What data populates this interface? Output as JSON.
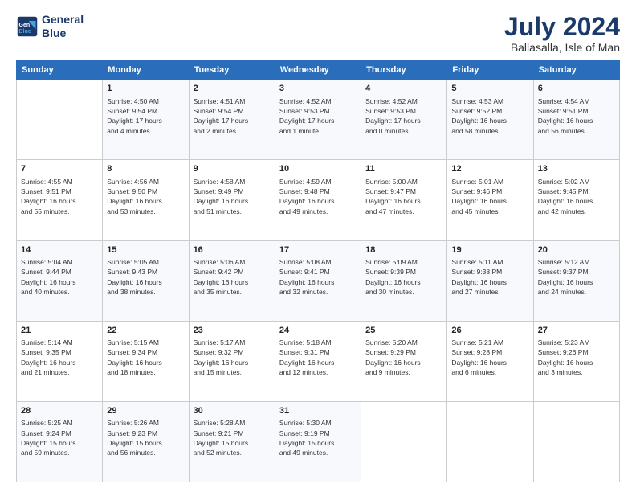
{
  "logo": {
    "line1": "General",
    "line2": "Blue"
  },
  "title": "July 2024",
  "subtitle": "Ballasalla, Isle of Man",
  "days_header": [
    "Sunday",
    "Monday",
    "Tuesday",
    "Wednesday",
    "Thursday",
    "Friday",
    "Saturday"
  ],
  "weeks": [
    [
      {
        "num": "",
        "info": ""
      },
      {
        "num": "1",
        "info": "Sunrise: 4:50 AM\nSunset: 9:54 PM\nDaylight: 17 hours\nand 4 minutes."
      },
      {
        "num": "2",
        "info": "Sunrise: 4:51 AM\nSunset: 9:54 PM\nDaylight: 17 hours\nand 2 minutes."
      },
      {
        "num": "3",
        "info": "Sunrise: 4:52 AM\nSunset: 9:53 PM\nDaylight: 17 hours\nand 1 minute."
      },
      {
        "num": "4",
        "info": "Sunrise: 4:52 AM\nSunset: 9:53 PM\nDaylight: 17 hours\nand 0 minutes."
      },
      {
        "num": "5",
        "info": "Sunrise: 4:53 AM\nSunset: 9:52 PM\nDaylight: 16 hours\nand 58 minutes."
      },
      {
        "num": "6",
        "info": "Sunrise: 4:54 AM\nSunset: 9:51 PM\nDaylight: 16 hours\nand 56 minutes."
      }
    ],
    [
      {
        "num": "7",
        "info": "Sunrise: 4:55 AM\nSunset: 9:51 PM\nDaylight: 16 hours\nand 55 minutes."
      },
      {
        "num": "8",
        "info": "Sunrise: 4:56 AM\nSunset: 9:50 PM\nDaylight: 16 hours\nand 53 minutes."
      },
      {
        "num": "9",
        "info": "Sunrise: 4:58 AM\nSunset: 9:49 PM\nDaylight: 16 hours\nand 51 minutes."
      },
      {
        "num": "10",
        "info": "Sunrise: 4:59 AM\nSunset: 9:48 PM\nDaylight: 16 hours\nand 49 minutes."
      },
      {
        "num": "11",
        "info": "Sunrise: 5:00 AM\nSunset: 9:47 PM\nDaylight: 16 hours\nand 47 minutes."
      },
      {
        "num": "12",
        "info": "Sunrise: 5:01 AM\nSunset: 9:46 PM\nDaylight: 16 hours\nand 45 minutes."
      },
      {
        "num": "13",
        "info": "Sunrise: 5:02 AM\nSunset: 9:45 PM\nDaylight: 16 hours\nand 42 minutes."
      }
    ],
    [
      {
        "num": "14",
        "info": "Sunrise: 5:04 AM\nSunset: 9:44 PM\nDaylight: 16 hours\nand 40 minutes."
      },
      {
        "num": "15",
        "info": "Sunrise: 5:05 AM\nSunset: 9:43 PM\nDaylight: 16 hours\nand 38 minutes."
      },
      {
        "num": "16",
        "info": "Sunrise: 5:06 AM\nSunset: 9:42 PM\nDaylight: 16 hours\nand 35 minutes."
      },
      {
        "num": "17",
        "info": "Sunrise: 5:08 AM\nSunset: 9:41 PM\nDaylight: 16 hours\nand 32 minutes."
      },
      {
        "num": "18",
        "info": "Sunrise: 5:09 AM\nSunset: 9:39 PM\nDaylight: 16 hours\nand 30 minutes."
      },
      {
        "num": "19",
        "info": "Sunrise: 5:11 AM\nSunset: 9:38 PM\nDaylight: 16 hours\nand 27 minutes."
      },
      {
        "num": "20",
        "info": "Sunrise: 5:12 AM\nSunset: 9:37 PM\nDaylight: 16 hours\nand 24 minutes."
      }
    ],
    [
      {
        "num": "21",
        "info": "Sunrise: 5:14 AM\nSunset: 9:35 PM\nDaylight: 16 hours\nand 21 minutes."
      },
      {
        "num": "22",
        "info": "Sunrise: 5:15 AM\nSunset: 9:34 PM\nDaylight: 16 hours\nand 18 minutes."
      },
      {
        "num": "23",
        "info": "Sunrise: 5:17 AM\nSunset: 9:32 PM\nDaylight: 16 hours\nand 15 minutes."
      },
      {
        "num": "24",
        "info": "Sunrise: 5:18 AM\nSunset: 9:31 PM\nDaylight: 16 hours\nand 12 minutes."
      },
      {
        "num": "25",
        "info": "Sunrise: 5:20 AM\nSunset: 9:29 PM\nDaylight: 16 hours\nand 9 minutes."
      },
      {
        "num": "26",
        "info": "Sunrise: 5:21 AM\nSunset: 9:28 PM\nDaylight: 16 hours\nand 6 minutes."
      },
      {
        "num": "27",
        "info": "Sunrise: 5:23 AM\nSunset: 9:26 PM\nDaylight: 16 hours\nand 3 minutes."
      }
    ],
    [
      {
        "num": "28",
        "info": "Sunrise: 5:25 AM\nSunset: 9:24 PM\nDaylight: 15 hours\nand 59 minutes."
      },
      {
        "num": "29",
        "info": "Sunrise: 5:26 AM\nSunset: 9:23 PM\nDaylight: 15 hours\nand 56 minutes."
      },
      {
        "num": "30",
        "info": "Sunrise: 5:28 AM\nSunset: 9:21 PM\nDaylight: 15 hours\nand 52 minutes."
      },
      {
        "num": "31",
        "info": "Sunrise: 5:30 AM\nSunset: 9:19 PM\nDaylight: 15 hours\nand 49 minutes."
      },
      {
        "num": "",
        "info": ""
      },
      {
        "num": "",
        "info": ""
      },
      {
        "num": "",
        "info": ""
      }
    ]
  ]
}
